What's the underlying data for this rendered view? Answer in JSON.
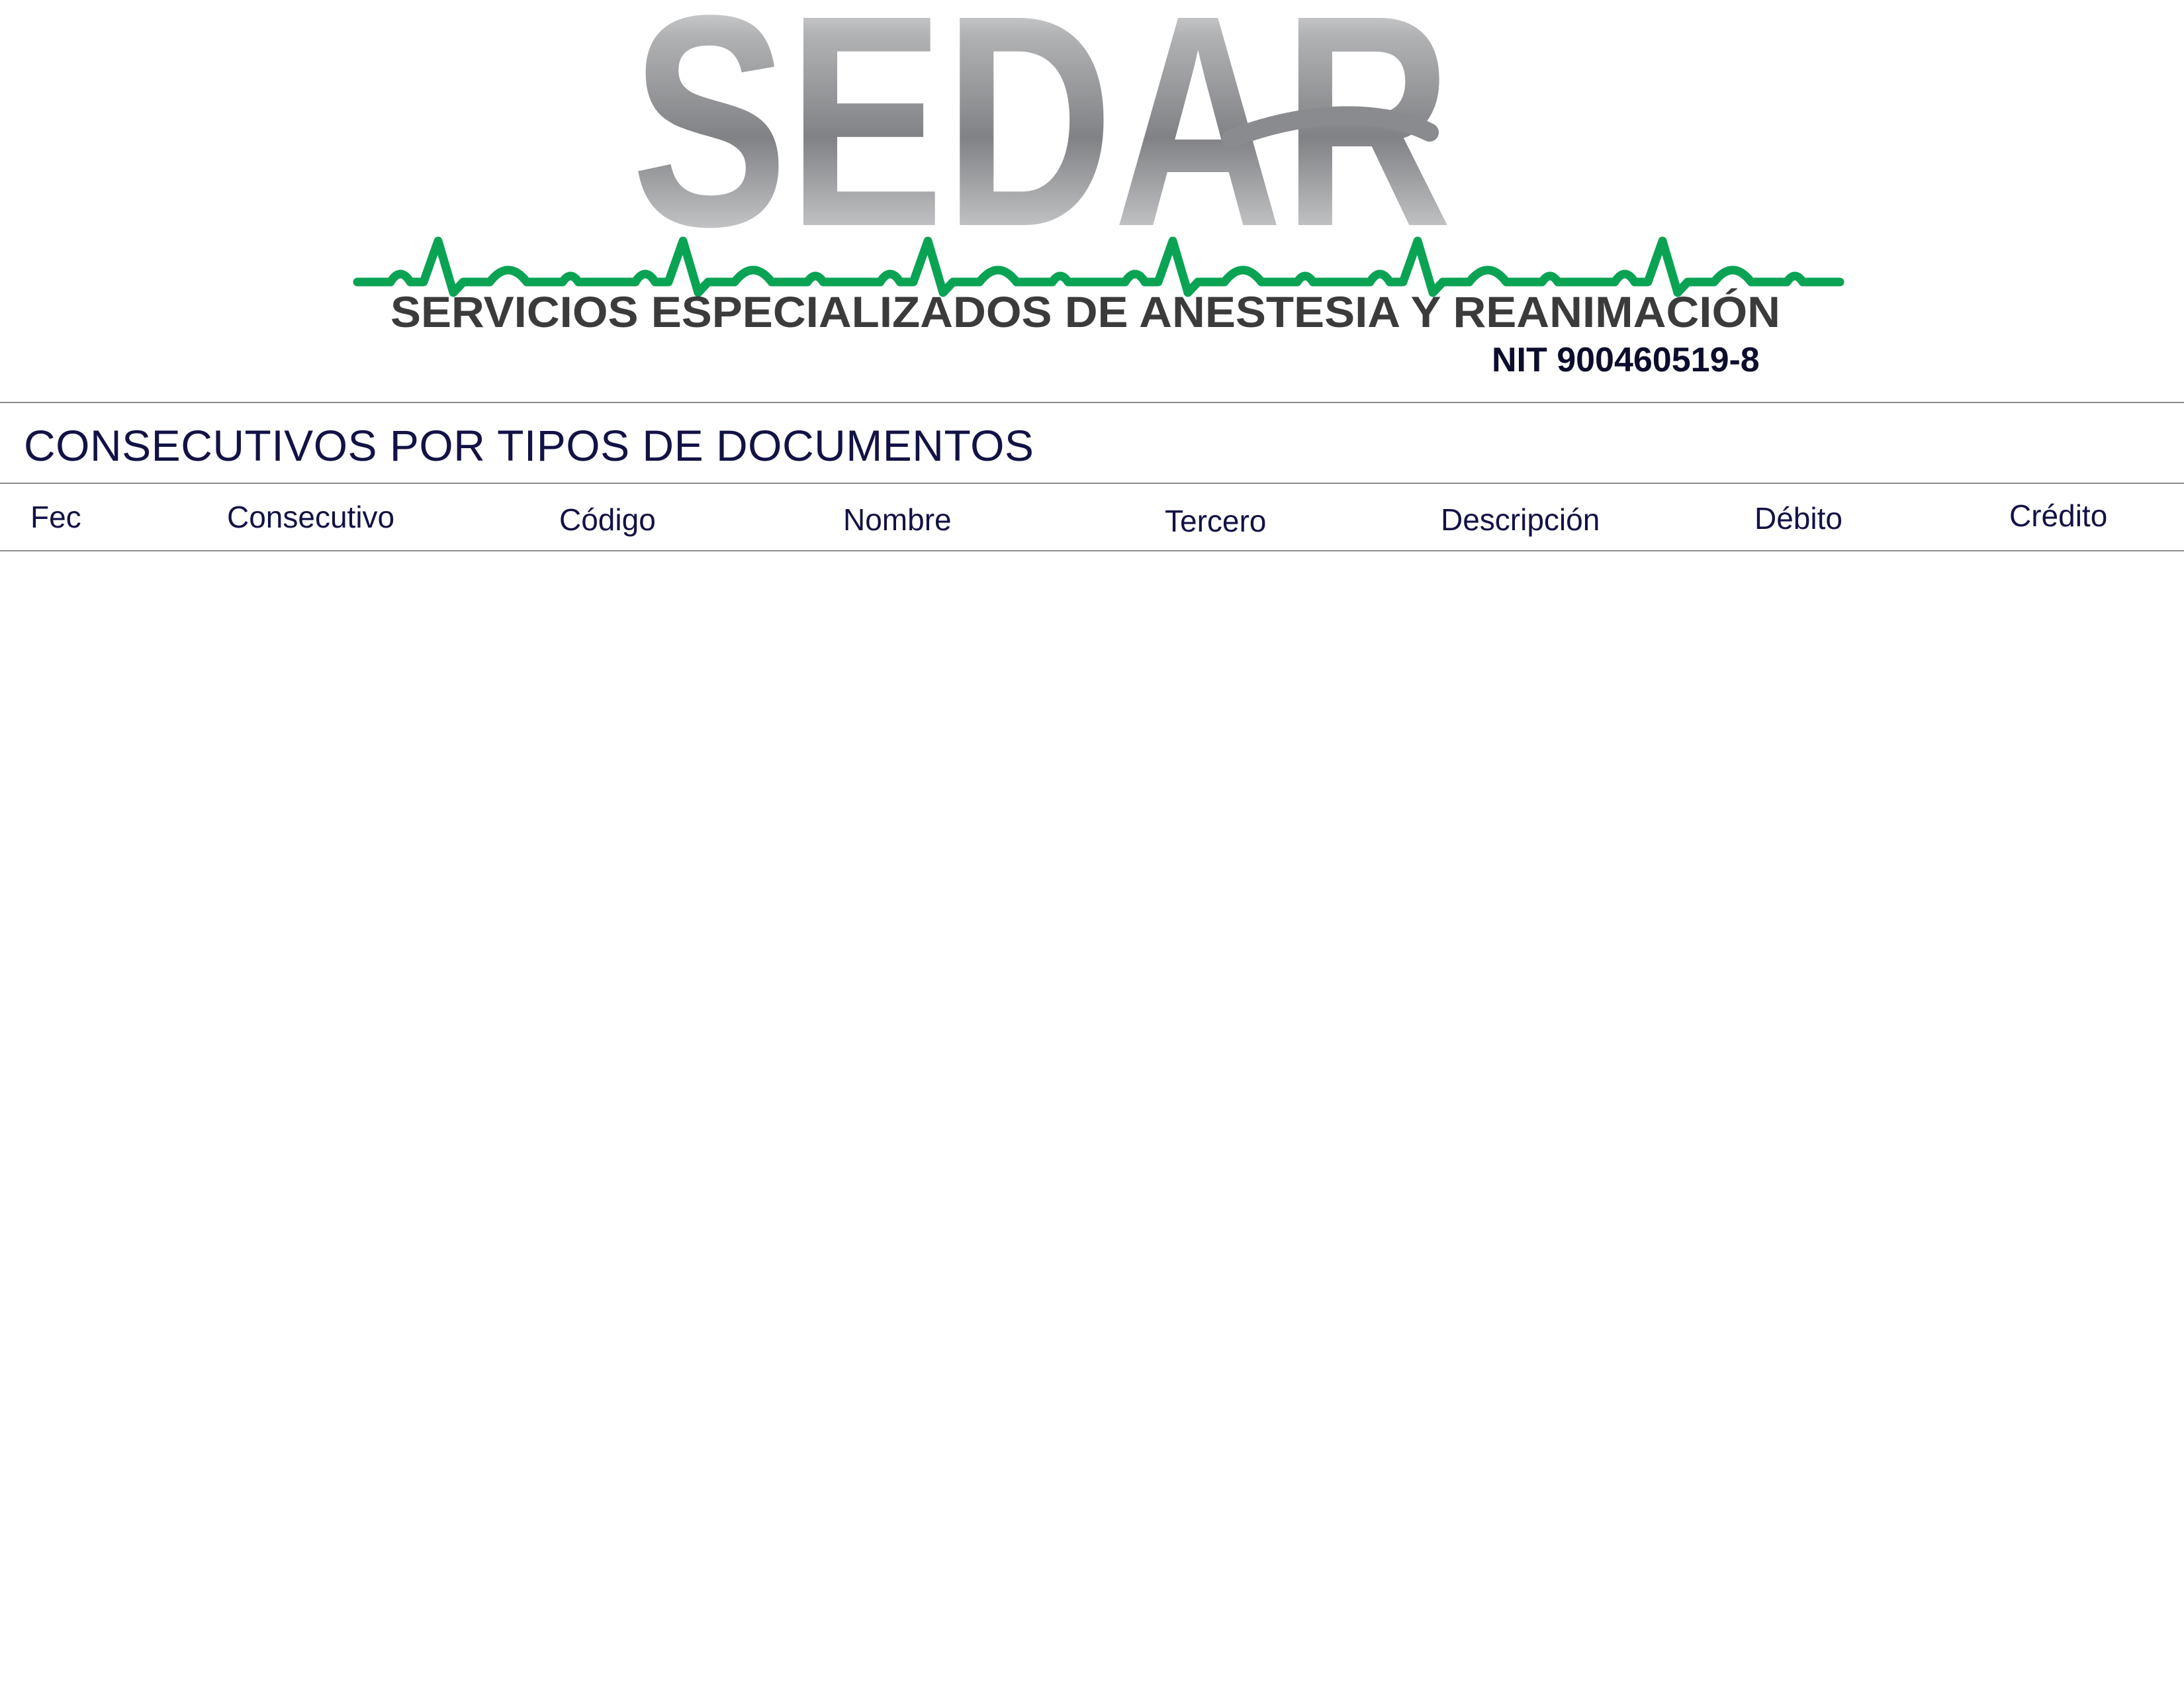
{
  "logo": {
    "wordmark": "SEDAR",
    "tagline": "SERVICIOS ESPECIALIZADOS DE ANESTESIA Y REANIMACIÓN",
    "heartbeat_color": "#0aa354"
  },
  "company": {
    "nit": "NIT 900460519-8"
  },
  "report": {
    "title": "CONSECUTIVOS POR TIPOS DE DOCUMENTOS"
  },
  "table": {
    "columns": [
      "Fec",
      "Consecutivo",
      "Código",
      "Nombre",
      "Tercero",
      "Descripción",
      "Débito",
      "Crédito"
    ]
  }
}
